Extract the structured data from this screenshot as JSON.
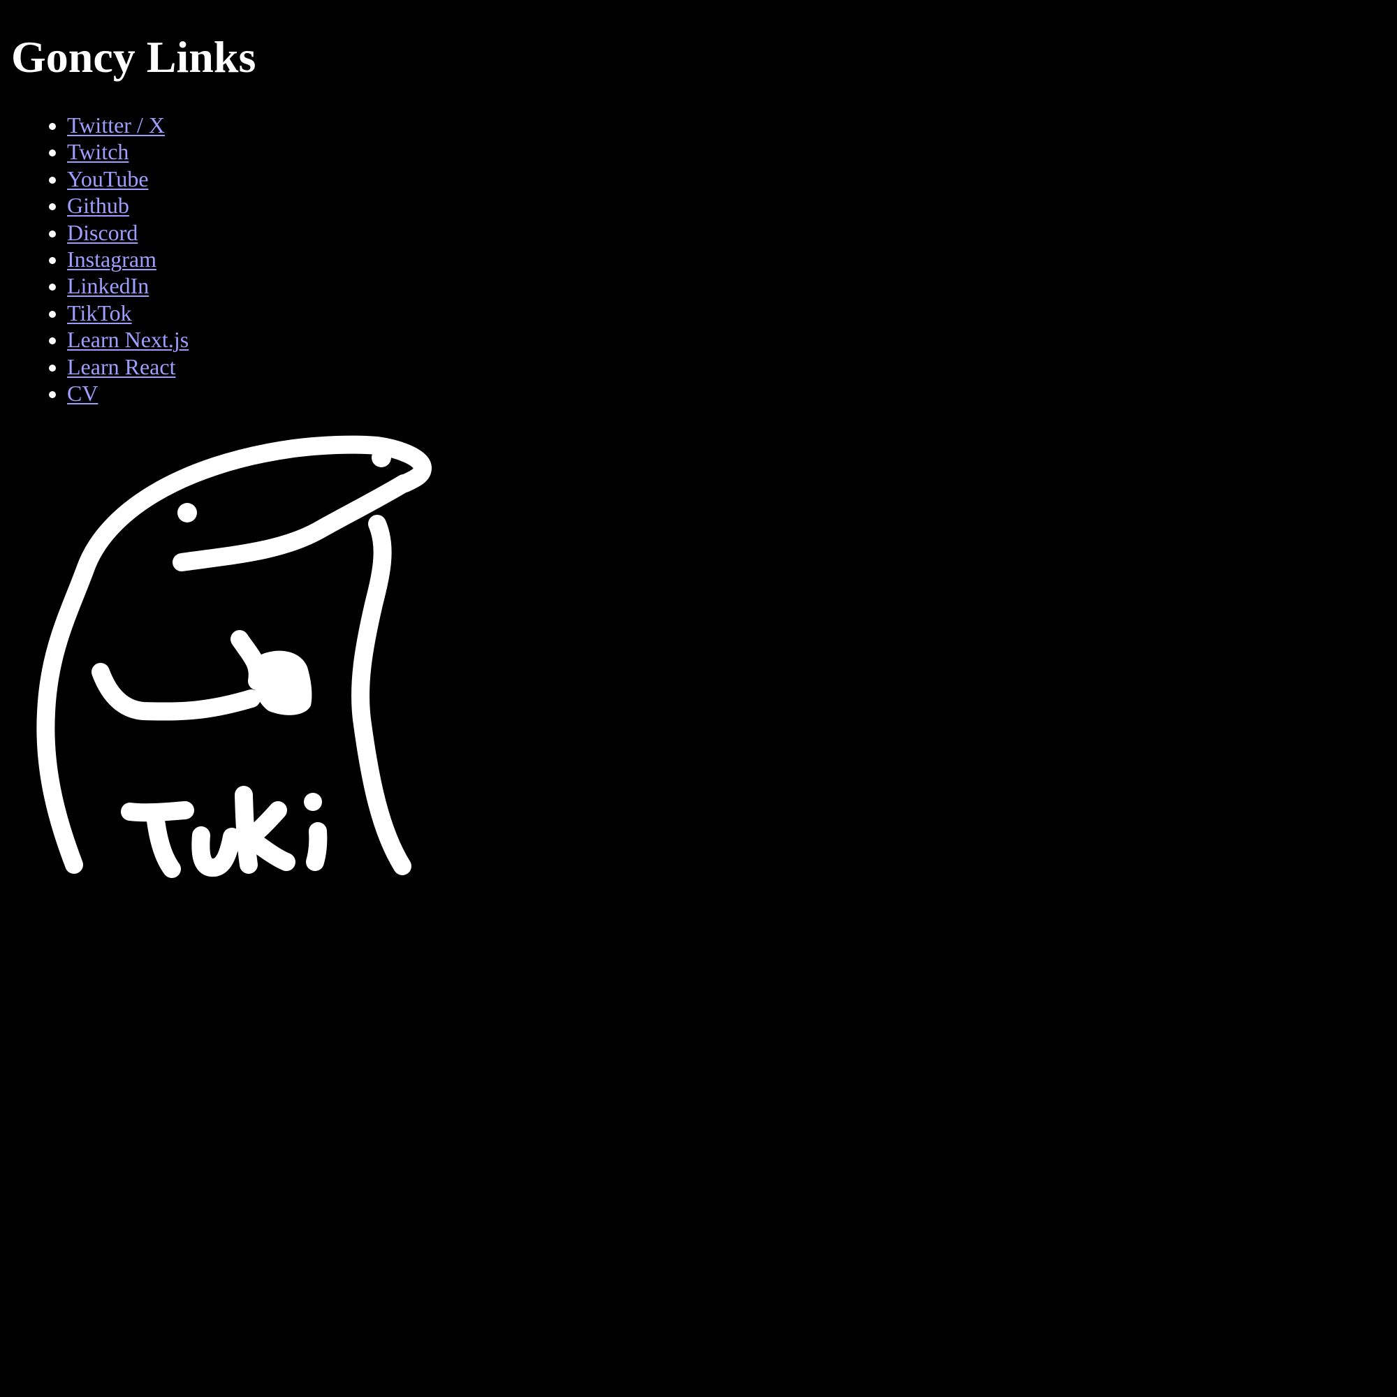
{
  "page": {
    "title": "Goncy Links"
  },
  "links": [
    {
      "label": "Twitter / X"
    },
    {
      "label": "Twitch"
    },
    {
      "label": "YouTube"
    },
    {
      "label": "Github"
    },
    {
      "label": "Discord"
    },
    {
      "label": "Instagram"
    },
    {
      "label": "LinkedIn"
    },
    {
      "label": "TikTok"
    },
    {
      "label": "Learn Next.js"
    },
    {
      "label": "Learn React"
    },
    {
      "label": "CV"
    }
  ],
  "mascot": {
    "icon": "tuki-mascot-icon",
    "caption": "Tuki"
  },
  "colors": {
    "background": "#000000",
    "text": "#ffffff",
    "link": "#9e9eff"
  }
}
